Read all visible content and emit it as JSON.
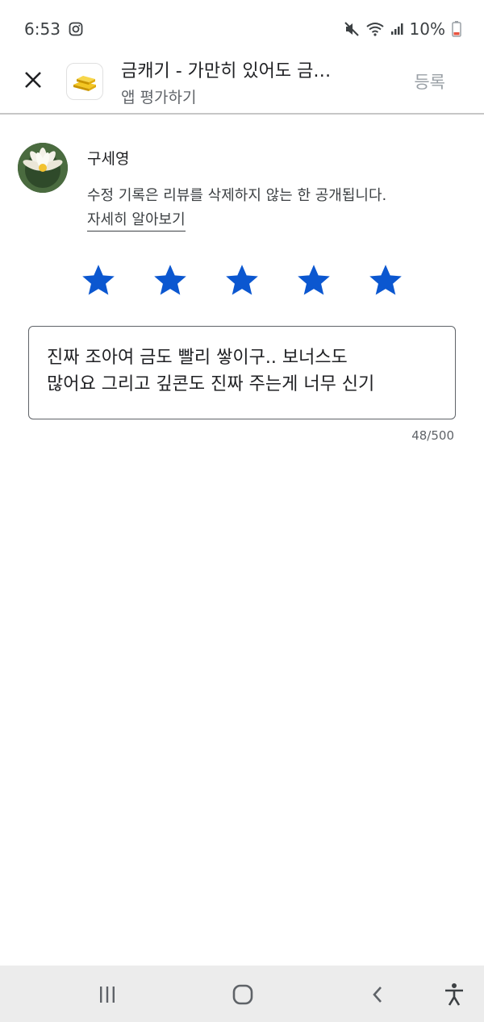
{
  "status_bar": {
    "time": "6:53",
    "battery_percent": "10%",
    "icons": [
      "instagram-icon",
      "mute-icon",
      "wifi-icon",
      "signal-icon",
      "battery-icon"
    ]
  },
  "header": {
    "app_title": "금캐기 - 가만히 있어도 금…",
    "subtitle": "앱 평가하기",
    "submit_label": "등록",
    "close_icon": "close-icon"
  },
  "user": {
    "name": "구세영",
    "edit_notice": "수정 기록은 리뷰를 삭제하지 않는 한 공개됩니다.",
    "learn_more": "자세히 알아보기"
  },
  "rating": {
    "value": 5,
    "max": 5,
    "star_color": "#0b57d0"
  },
  "review": {
    "text": "진짜 조아여 금도 빨리 쌓이구.. 보너스도\n많어요 그리고 깊콘도 진짜 주는게 너무 신기",
    "char_count": "48/500"
  },
  "nav_bar": {
    "icons": [
      "recent-apps-icon",
      "home-icon",
      "back-icon",
      "accessibility-icon"
    ]
  }
}
